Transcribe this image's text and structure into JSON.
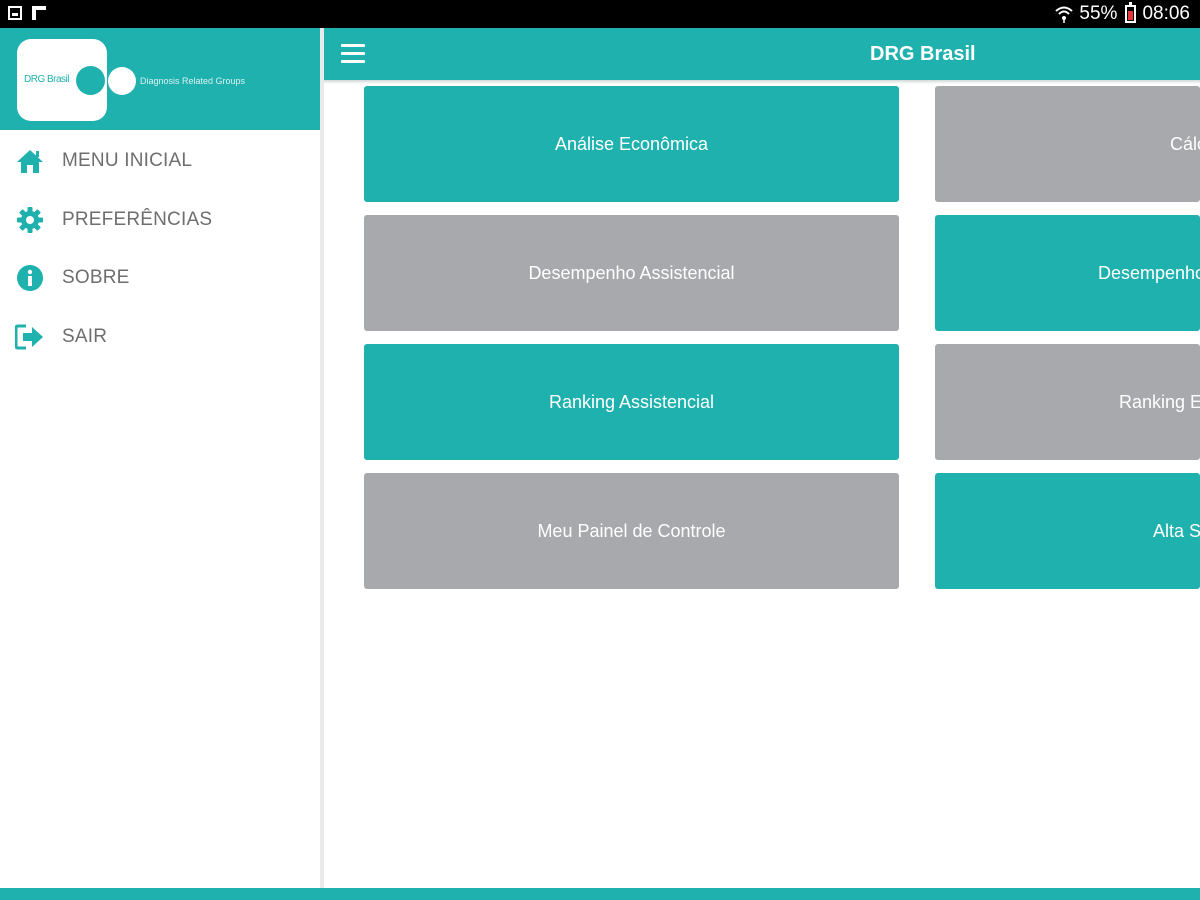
{
  "status_bar": {
    "battery": "55%",
    "time": "08:06"
  },
  "drawer": {
    "logo_text": "DRG Brasil",
    "logo_subtitle": "Diagnosis Related Groups",
    "items": [
      {
        "label": "MENU INICIAL",
        "icon": "home-icon"
      },
      {
        "label": "PREFERÊNCIAS",
        "icon": "gear-icon"
      },
      {
        "label": "SOBRE",
        "icon": "info-icon"
      },
      {
        "label": "SAIR",
        "icon": "exit-icon"
      }
    ]
  },
  "app_bar": {
    "title": "DRG Brasil",
    "menu_icon": "hamburger-icon"
  },
  "tiles": {
    "left": [
      {
        "label": "Análise Econômica",
        "color": "#1fb1ad"
      },
      {
        "label": "Desempenho Assistencial",
        "color": "#a7a9ac"
      },
      {
        "label": "Ranking Assistencial",
        "color": "#1fb1ad"
      },
      {
        "label": "Meu Painel de Controle",
        "color": "#a7a9ac"
      }
    ],
    "right": [
      {
        "label": "Cálc",
        "color": "#a7a9ac"
      },
      {
        "label": "Desempenho",
        "color": "#1fb1ad"
      },
      {
        "label": "Ranking E",
        "color": "#a7a9ac"
      },
      {
        "label": "Alta S",
        "color": "#1fb1ad"
      }
    ]
  },
  "colors": {
    "accent": "#1fb1ad",
    "tile_gray": "#a7a9ac",
    "menu_text": "#6e6e6e"
  }
}
